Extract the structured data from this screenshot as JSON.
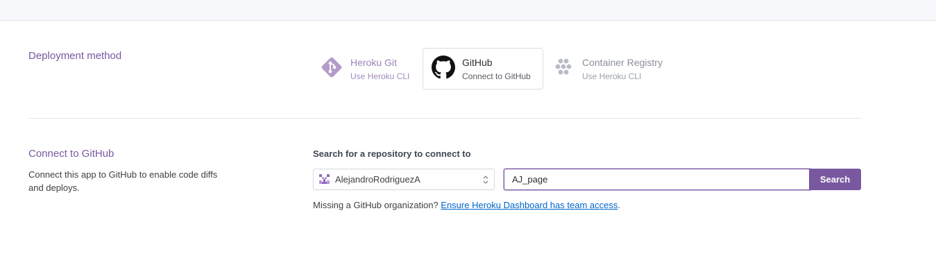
{
  "deployment": {
    "title": "Deployment method",
    "methods": [
      {
        "name": "Heroku Git",
        "sub": "Use Heroku CLI",
        "icon": "git-icon"
      },
      {
        "name": "GitHub",
        "sub": "Connect to GitHub",
        "icon": "github-icon"
      },
      {
        "name": "Container Registry",
        "sub": "Use Heroku CLI",
        "icon": "container-icon"
      }
    ],
    "active_method": "GitHub"
  },
  "connect": {
    "title": "Connect to GitHub",
    "description": "Connect this app to GitHub to enable code diffs and deploys.",
    "search_label": "Search for a repository to connect to",
    "org_select": {
      "value": "AlejandroRodriguezA",
      "icon": "org-avatar-icon"
    },
    "search_value": "AJ_page",
    "search_button": "Search",
    "missing_text": "Missing a GitHub organization?",
    "missing_link": "Ensure Heroku Dashboard has team access",
    "missing_suffix": "."
  },
  "colors": {
    "brand": "#79589f",
    "link": "#0066cc"
  }
}
